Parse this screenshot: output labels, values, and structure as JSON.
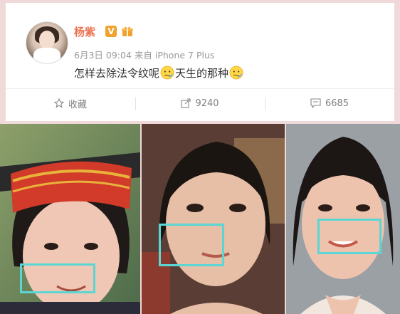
{
  "post": {
    "username": "杨紫",
    "verified_badge": "V",
    "meta": "6月3日 09:04 来自 iPhone 7 Plus",
    "text_part1": "怎样去除法令纹呢",
    "text_part2": "天生的那种"
  },
  "actions": {
    "favorite_label": "收藏",
    "repost_count": "9240",
    "comment_count": "6685"
  },
  "icons": {
    "favorite": "star-outline-icon",
    "repost": "share-arrow-icon",
    "comment": "speech-bubble-icon",
    "emoji": "confused-face-emoji-icon",
    "vip": "gift-vip-icon"
  },
  "colors": {
    "username": "#eb7350",
    "marker": "#5ad6d4",
    "meta": "#999999"
  },
  "photos": [
    {
      "label": "child-graduation-photo"
    },
    {
      "label": "teen-photo"
    },
    {
      "label": "adult-photo"
    }
  ]
}
